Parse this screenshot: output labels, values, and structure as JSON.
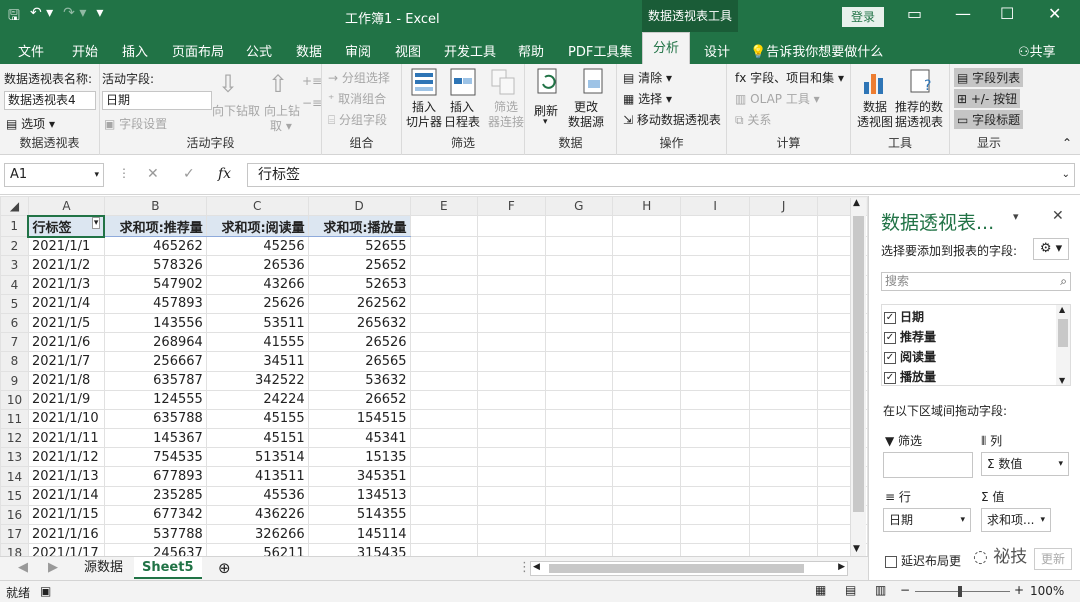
{
  "window": {
    "title": "工作簿1  -  Excel",
    "context_tab": "数据透视表工具",
    "login": "登录"
  },
  "tabs": [
    "文件",
    "开始",
    "插入",
    "页面布局",
    "公式",
    "数据",
    "审阅",
    "视图",
    "开发工具",
    "帮助",
    "PDF工具集",
    "分析",
    "设计"
  ],
  "tell_me": "告诉我你想要做什么",
  "share": "共享",
  "ribbon": {
    "pivot_name_label": "数据透视表名称:",
    "pivot_name_value": "数据透视表4",
    "options": "选项",
    "group_pivot": "数据透视表",
    "active_field_label": "活动字段:",
    "active_field_value": "日期",
    "field_settings": "字段设置",
    "drill_down": "向下钻取",
    "drill_up": "向上钻",
    "drill_up2": "取 ▾",
    "group_active": "活动字段",
    "group_sel": "分组选择",
    "ungroup": "取消组合",
    "group_field": "分组字段",
    "group_group": "组合",
    "slicer": "插入\n切片器",
    "timeline": "插入\n日程表",
    "filter_conn": "筛选\n器连接",
    "group_filter": "筛选",
    "refresh": "刷新",
    "change_src": "更改\n数据源",
    "group_data": "数据",
    "clear": "清除",
    "select": "选择",
    "move": "移动数据透视表",
    "group_ops": "操作",
    "fields_items": "字段、项目和集",
    "olap": "OLAP 工具",
    "relations": "关系",
    "group_calc": "计算",
    "pivotchart": "数据\n透视图",
    "recommend": "推荐的数\n据透视表",
    "group_tools": "工具",
    "field_list": "字段列表",
    "pm_buttons": "+/- 按钮",
    "field_headers": "字段标题",
    "group_show": "显示"
  },
  "namebox": "A1",
  "formula": "行标签",
  "columns": [
    "A",
    "B",
    "C",
    "D",
    "E",
    "F",
    "G",
    "H",
    "I",
    "J"
  ],
  "header_row": [
    "行标签",
    "求和项:推荐量",
    "求和项:阅读量",
    "求和项:播放量"
  ],
  "rows": [
    [
      "2021/1/1",
      "465262",
      "45256",
      "52655"
    ],
    [
      "2021/1/2",
      "578326",
      "26536",
      "25652"
    ],
    [
      "2021/1/3",
      "547902",
      "43266",
      "52653"
    ],
    [
      "2021/1/4",
      "457893",
      "25626",
      "262562"
    ],
    [
      "2021/1/5",
      "143556",
      "53511",
      "265632"
    ],
    [
      "2021/1/6",
      "268964",
      "41555",
      "26526"
    ],
    [
      "2021/1/7",
      "256667",
      "34511",
      "26565"
    ],
    [
      "2021/1/8",
      "635787",
      "342522",
      "53632"
    ],
    [
      "2021/1/9",
      "124555",
      "24224",
      "26652"
    ],
    [
      "2021/1/10",
      "635788",
      "45155",
      "154515"
    ],
    [
      "2021/1/11",
      "145367",
      "45151",
      "45341"
    ],
    [
      "2021/1/12",
      "754535",
      "513514",
      "15135"
    ],
    [
      "2021/1/13",
      "677893",
      "413511",
      "345351"
    ],
    [
      "2021/1/14",
      "235285",
      "45536",
      "134513"
    ],
    [
      "2021/1/15",
      "677342",
      "436226",
      "514355"
    ],
    [
      "2021/1/16",
      "537788",
      "326266",
      "145114"
    ],
    [
      "2021/1/17",
      "245637",
      "56211",
      "315435"
    ]
  ],
  "sheets": [
    "源数据",
    "Sheet5"
  ],
  "status": {
    "ready": "就绪",
    "zoom": "100%"
  },
  "pane": {
    "title": "数据透视表...",
    "choose_fields": "选择要添加到报表的字段:",
    "search_placeholder": "搜索",
    "fields": [
      "日期",
      "推荐量",
      "阅读量",
      "播放量"
    ],
    "drag_label": "在以下区域间拖动字段:",
    "filters": "筛选",
    "columns": "列",
    "rows": "行",
    "values": "值",
    "col_value": "Σ 数值",
    "row_value": "日期",
    "val_value": "求和项...",
    "defer": "延迟布局更",
    "update": "更新",
    "watermark": "祕技"
  }
}
